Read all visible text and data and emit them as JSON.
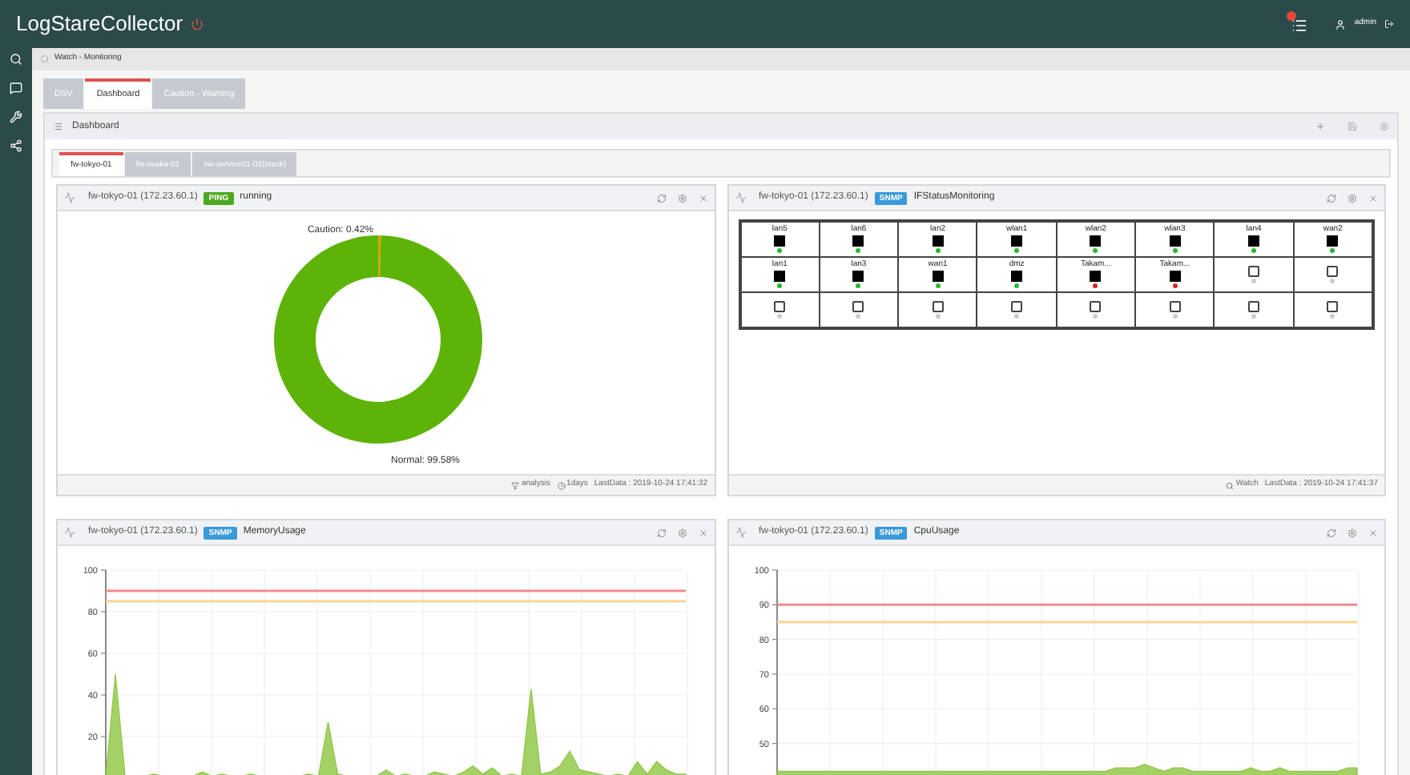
{
  "header": {
    "title": "LogStareCollector",
    "user": "admin"
  },
  "breadcrumb": "Watch - Monitoring",
  "tabs": [
    {
      "label": "DSV",
      "selected": false
    },
    {
      "label": "Dashboard",
      "selected": true
    },
    {
      "label": "Caution - Warning",
      "selected": false
    }
  ],
  "dashboard": {
    "title": "Dashboard",
    "tabs": [
      {
        "label": "fw-tokyo-01",
        "selected": true
      },
      {
        "label": "fw-osaka-01",
        "selected": false
      },
      {
        "label": "sw-service01-02(stack)",
        "selected": false
      }
    ],
    "widgets": [
      {
        "kind": "donut",
        "host": "fw-tokyo-01 (172.23.60.1)",
        "badge": {
          "text": "PING",
          "color": "#4ca81e"
        },
        "title": "running",
        "chart_data": {
          "type": "donut",
          "values": [
            0.42,
            99.58
          ],
          "colors": [
            "#d9a400",
            "#5db308"
          ],
          "value_labels": [
            "Caution: 0.42%",
            "Normal: 99.58%"
          ]
        },
        "footer": {
          "action": "analysis",
          "period": "1days",
          "last_data": "LastData : 2019-10-24 17:41:32"
        }
      },
      {
        "kind": "ports",
        "host": "fw-tokyo-01 (172.23.60.1)",
        "badge": {
          "text": "SNMP",
          "color": "#3a9ad9"
        },
        "title": "IFStatusMonitoring",
        "ports": [
          {
            "label": "lan5",
            "kind": "up",
            "color": "#22bb33"
          },
          {
            "label": "lan6",
            "kind": "up",
            "color": "#22bb33"
          },
          {
            "label": "lan2",
            "kind": "up",
            "color": "#22bb33"
          },
          {
            "label": "wlan1",
            "kind": "up",
            "color": "#22bb33"
          },
          {
            "label": "wlan2",
            "kind": "up",
            "color": "#22bb33"
          },
          {
            "label": "wlan3",
            "kind": "up",
            "color": "#22bb33"
          },
          {
            "label": "lan4",
            "kind": "up",
            "color": "#22bb33"
          },
          {
            "label": "wan2",
            "kind": "up",
            "color": "#22bb33"
          },
          {
            "label": "lan1",
            "kind": "up",
            "color": "#22bb33"
          },
          {
            "label": "lan3",
            "kind": "up",
            "color": "#22bb33"
          },
          {
            "label": "wan1",
            "kind": "up",
            "color": "#22bb33"
          },
          {
            "label": "dmz",
            "kind": "up",
            "color": "#22bb33"
          },
          {
            "label": "Takam...",
            "kind": "up",
            "color": "#dd2222"
          },
          {
            "label": "Takam...",
            "kind": "up",
            "color": "#dd2222"
          },
          {
            "kind": "empty",
            "color": "#cccccc"
          },
          {
            "kind": "empty",
            "color": "#cccccc"
          },
          {
            "kind": "empty",
            "color": "#cccccc"
          },
          {
            "kind": "empty",
            "color": "#cccccc"
          },
          {
            "kind": "empty",
            "color": "#cccccc"
          },
          {
            "kind": "empty",
            "color": "#cccccc"
          },
          {
            "kind": "empty",
            "color": "#cccccc"
          },
          {
            "kind": "empty",
            "color": "#cccccc"
          },
          {
            "kind": "empty",
            "color": "#cccccc"
          },
          {
            "kind": "empty",
            "color": "#cccccc"
          }
        ],
        "footer": {
          "action": "Watch",
          "last_data": "LastData : 2019-10-24 17:41:37"
        }
      },
      {
        "kind": "area",
        "host": "fw-tokyo-01 (172.23.60.1)",
        "badge": {
          "text": "SNMP",
          "color": "#3a9ad9"
        },
        "title": "MemoryUsage",
        "chart_data": {
          "type": "area",
          "grid": true,
          "ylim": [
            0,
            100
          ],
          "yticks": [
            20,
            40,
            60,
            80,
            100
          ],
          "series": [
            {
              "type": "area",
              "color": "#8cc63f",
              "values": [
                1,
                50,
                1,
                1,
                1,
                2,
                1,
                1,
                1,
                1,
                3,
                1,
                2,
                1,
                1,
                2,
                1,
                1,
                1,
                1,
                1,
                2,
                1,
                27,
                2,
                1,
                1,
                1,
                1,
                4,
                1,
                2,
                1,
                1,
                3,
                2,
                1,
                3,
                6,
                2,
                5,
                1,
                2,
                1,
                43,
                2,
                3,
                6,
                13,
                4,
                3,
                2,
                1,
                2,
                1,
                8,
                2,
                8,
                4,
                2,
                2
              ]
            },
            {
              "type": "line",
              "color": "#f28b8b",
              "values": [
                90,
                90,
                90,
                90,
                90,
                90,
                90,
                90,
                90,
                90,
                90,
                90,
                90,
                90,
                90,
                90,
                90,
                90,
                90,
                90,
                90,
                90,
                90,
                90,
                90,
                90,
                90,
                90,
                90,
                90,
                90,
                90,
                90,
                90,
                90,
                90,
                90,
                90,
                90,
                90,
                90,
                90,
                90,
                90,
                90,
                90,
                90,
                90,
                90,
                90,
                90,
                90,
                90,
                90,
                90,
                90,
                90,
                90,
                90,
                90,
                90
              ]
            },
            {
              "type": "line",
              "color": "#fdd491",
              "values": [
                85,
                85,
                85,
                85,
                85,
                85,
                85,
                85,
                85,
                85,
                85,
                85,
                85,
                85,
                85,
                85,
                85,
                85,
                85,
                85,
                85,
                85,
                85,
                85,
                85,
                85,
                85,
                85,
                85,
                85,
                85,
                85,
                85,
                85,
                85,
                85,
                85,
                85,
                85,
                85,
                85,
                85,
                85,
                85,
                85,
                85,
                85,
                85,
                85,
                85,
                85,
                85,
                85,
                85,
                85,
                85,
                85,
                85,
                85,
                85,
                85
              ]
            }
          ]
        }
      },
      {
        "kind": "area",
        "host": "fw-tokyo-01 (172.23.60.1)",
        "badge": {
          "text": "SNMP",
          "color": "#3a9ad9"
        },
        "title": "CpuUsage",
        "chart_data": {
          "type": "area",
          "grid": true,
          "ylim": [
            40,
            100
          ],
          "yticks": [
            50,
            60,
            70,
            80,
            90,
            100
          ],
          "series": [
            {
              "type": "area",
              "color": "#8cc63f",
              "values": [
                42,
                42,
                42,
                42,
                42,
                42,
                42,
                42,
                42,
                42,
                42,
                42,
                42,
                42,
                42,
                42,
                42,
                42,
                42,
                42,
                42,
                42,
                42,
                42,
                42,
                42,
                42,
                42,
                42,
                42,
                42,
                42,
                42,
                42,
                42,
                43,
                43,
                43,
                44,
                43,
                42,
                43,
                43,
                42,
                42,
                42,
                42,
                42,
                42,
                43,
                42,
                42,
                43,
                42,
                42,
                42,
                42,
                42,
                42,
                43,
                43
              ]
            },
            {
              "type": "line",
              "color": "#f28b8b",
              "values": [
                90,
                90,
                90,
                90,
                90,
                90,
                90,
                90,
                90,
                90,
                90,
                90,
                90,
                90,
                90,
                90,
                90,
                90,
                90,
                90,
                90,
                90,
                90,
                90,
                90,
                90,
                90,
                90,
                90,
                90,
                90,
                90,
                90,
                90,
                90,
                90,
                90,
                90,
                90,
                90,
                90,
                90,
                90,
                90,
                90,
                90,
                90,
                90,
                90,
                90,
                90,
                90,
                90,
                90,
                90,
                90,
                90,
                90,
                90,
                90,
                90
              ]
            },
            {
              "type": "line",
              "color": "#fdd491",
              "values": [
                85,
                85,
                85,
                85,
                85,
                85,
                85,
                85,
                85,
                85,
                85,
                85,
                85,
                85,
                85,
                85,
                85,
                85,
                85,
                85,
                85,
                85,
                85,
                85,
                85,
                85,
                85,
                85,
                85,
                85,
                85,
                85,
                85,
                85,
                85,
                85,
                85,
                85,
                85,
                85,
                85,
                85,
                85,
                85,
                85,
                85,
                85,
                85,
                85,
                85,
                85,
                85,
                85,
                85,
                85,
                85,
                85,
                85,
                85,
                85,
                85
              ]
            }
          ]
        }
      }
    ]
  }
}
